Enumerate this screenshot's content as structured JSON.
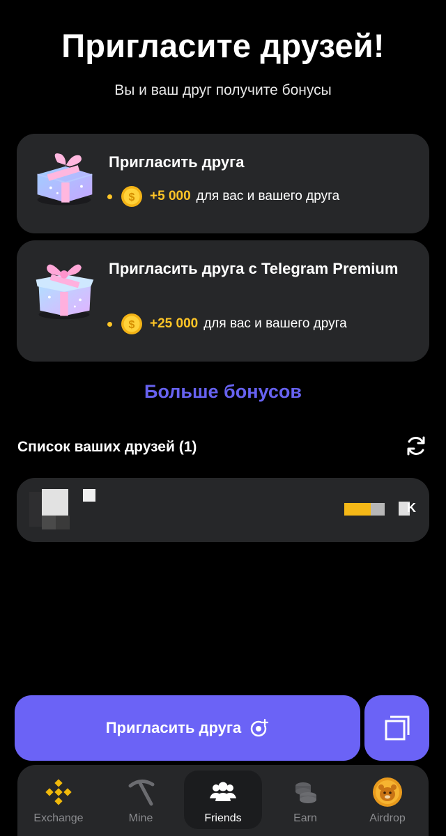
{
  "header": {
    "title": "Пригласите друзей!",
    "subtitle": "Вы и ваш друг получите бонусы"
  },
  "cards": [
    {
      "title": "Пригласить друга",
      "amount": "+5 000",
      "text": "для вас и вашего друга",
      "icon": "gift-icon"
    },
    {
      "title": "Пригласить друга с Telegram Premium",
      "amount": "+25 000",
      "text": "для вас и вашего друга",
      "icon": "gift-icon"
    }
  ],
  "more_bonuses": "Больше бонусов",
  "friends": {
    "header": "Список ваших друзей (1)",
    "refresh_icon": "refresh-icon",
    "count_suffix": "K"
  },
  "actions": {
    "invite_label": "Пригласить друга",
    "invite_icon": "add-contact-icon",
    "copy_icon": "copy-icon"
  },
  "nav": {
    "items": [
      {
        "label": "Exchange",
        "icon": "exchange-icon"
      },
      {
        "label": "Mine",
        "icon": "pickaxe-icon"
      },
      {
        "label": "Friends",
        "icon": "friends-icon"
      },
      {
        "label": "Earn",
        "icon": "coins-icon"
      },
      {
        "label": "Airdrop",
        "icon": "hamster-coin-icon"
      }
    ],
    "active": "Friends"
  },
  "colors": {
    "accent": "#6b63f6",
    "link": "#6762f0",
    "coin": "#ffc527",
    "card": "#262729",
    "background": "#000000"
  }
}
